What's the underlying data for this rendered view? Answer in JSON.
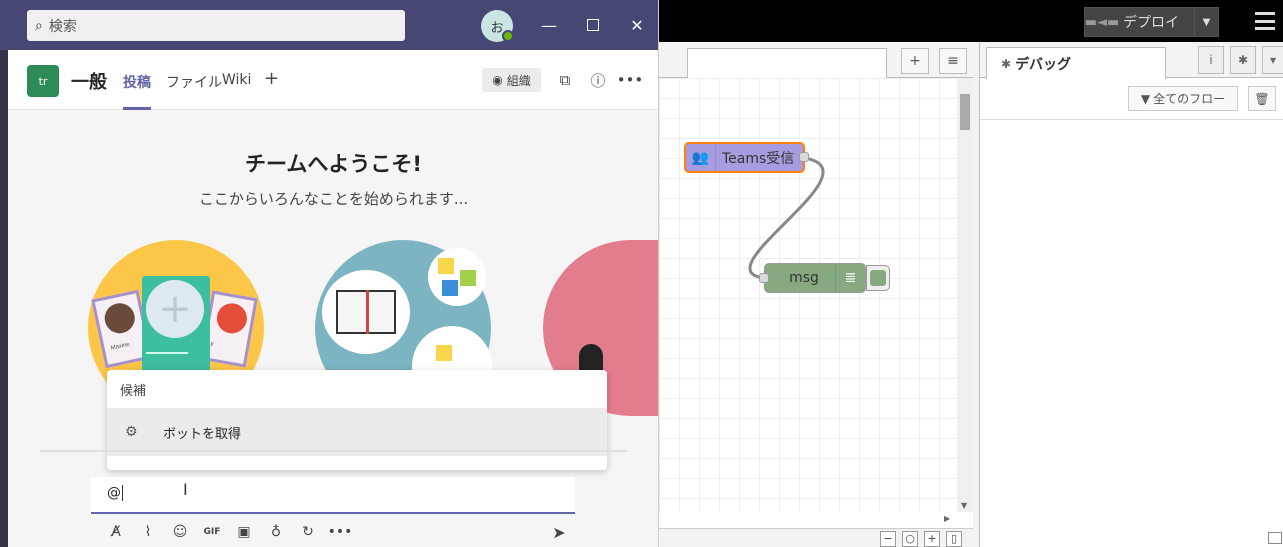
{
  "nodered": {
    "deploy_label": "デプロイ",
    "sidebar_tab_label": "デバッグ",
    "flow_filter_label": "全てのフロー",
    "nodes": {
      "teams_in_label": "Teams受信",
      "debug_label": "msg"
    },
    "colors": {
      "teams_node": "#a69ce0",
      "selected_outline": "#ff7f0e",
      "debug_node": "#87a980"
    }
  },
  "teams": {
    "search_placeholder": "検索",
    "avatar_initial": "お",
    "team_avatar_text": "tr",
    "channel_name": "一般",
    "tabs": [
      {
        "label": "投稿",
        "active": true
      },
      {
        "label": "ファイル",
        "active": false
      },
      {
        "label": "Wiki",
        "active": false
      }
    ],
    "add_tab_label": "+",
    "org_button_label": "組織",
    "welcome_title": "チームへようこそ!",
    "welcome_subtitle": "ここからいろんなことを始められます...",
    "illustration_card_name": "Maxine",
    "illustration_card_name_2": "y",
    "suggest_heading": "候補",
    "suggest_items": [
      {
        "label": "ボットを取得",
        "icon": "bot-icon"
      }
    ],
    "compose_value": "@",
    "accent_color": "#6264a7"
  }
}
